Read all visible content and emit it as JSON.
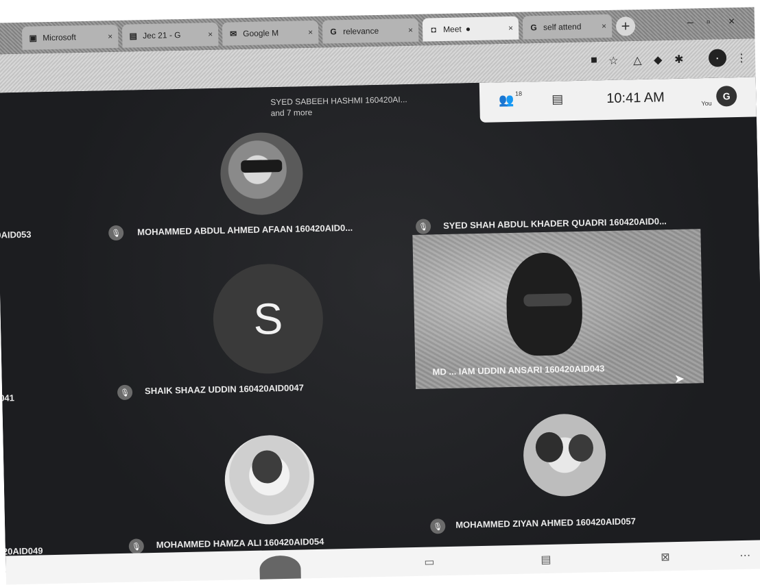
{
  "browser": {
    "tabs": [
      {
        "label": "Microsoft",
        "icon": "teams-icon"
      },
      {
        "label": "Jec 21 - G",
        "icon": "docs-icon"
      },
      {
        "label": "Google M",
        "icon": "gmail-icon"
      },
      {
        "label": "relevance",
        "icon": "google-icon"
      },
      {
        "label": "Meet",
        "icon": "meet-icon",
        "active": true
      },
      {
        "label": "self attend",
        "icon": "google-icon"
      }
    ],
    "tab_close_glyph": "×",
    "new_tab_glyph": "+"
  },
  "meet": {
    "speaker_line1": "SYED SABEEH HASHMI 160420AI...",
    "speaker_line2": "and 7 more",
    "participant_count": "18",
    "clock": "10:41 AM",
    "you_label": "You",
    "profile_initial": "G",
    "participants": {
      "p1": "MOHAMMED ABDUL AHMED AFAAN 160420AID0...",
      "p2": "SYED SHAH ABDUL KHADER QUADRI 160420AID0...",
      "p3": "SHAIK SHAAZ UDDIN 160420AID0047",
      "p4": "MD ... IAM UDDIN ANSARI 160420AID043",
      "p5": "MOHAMMED HAMZA ALI 160420AID054",
      "p6": "MOHAMMED ZIYAN AHMED 160420AID057",
      "edge1": "0AID053",
      "edge2": "041",
      "edge3": "20AID049"
    },
    "letter_avatar": "S"
  }
}
